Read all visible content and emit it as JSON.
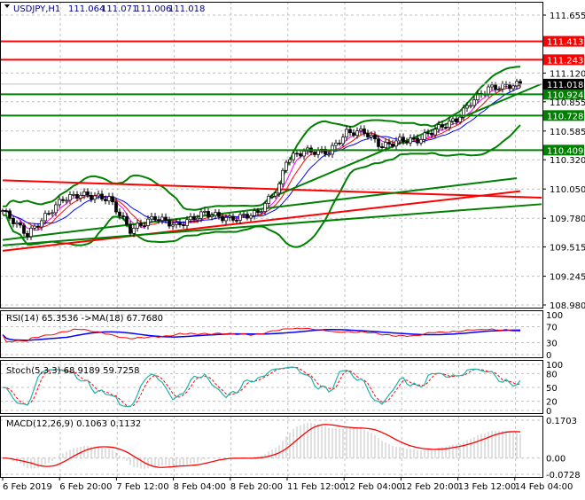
{
  "header": {
    "symbol": "USDJPY,H1",
    "open": "111.064",
    "high": "111.071",
    "low": "111.006",
    "close": "111.018"
  },
  "colors": {
    "bull": "#000000",
    "bear": "#000000",
    "level_red": "#ff0000",
    "level_green": "#008000",
    "current_price_bg": "#000000",
    "rsi": "#0000ff",
    "rsi_ma": "#ff0000",
    "stoch_main": "#20b2aa",
    "stoch_signal": "#ff0000",
    "macd_hist": "#c0c0c0",
    "macd_signal": "#ff0000",
    "grid": "#c0c0c0"
  },
  "chart_data": [
    {
      "type": "candlestick",
      "title": "USDJPY,H1",
      "timeframe": "H1",
      "ylim": [
        108.98,
        111.655
      ],
      "y_ticks": [
        "111.655",
        "111.120",
        "110.855",
        "110.585",
        "110.320",
        "110.050",
        "109.780",
        "109.515",
        "109.245",
        "108.980"
      ],
      "x_ticks": [
        "6 Feb 2019",
        "6 Feb 20:00",
        "7 Feb 12:00",
        "8 Feb 04:00",
        "8 Feb 20:00",
        "11 Feb 12:00",
        "12 Feb 04:00",
        "12 Feb 20:00",
        "13 Feb 12:00",
        "14 Feb 04:00"
      ],
      "close_path": [
        {
          "bar": 0,
          "close": 109.85
        },
        {
          "bar": 7,
          "close": 109.63
        },
        {
          "bar": 17,
          "close": 109.96
        },
        {
          "bar": 22,
          "close": 110.0
        },
        {
          "bar": 30,
          "close": 109.96
        },
        {
          "bar": 36,
          "close": 109.67
        },
        {
          "bar": 43,
          "close": 109.79
        },
        {
          "bar": 49,
          "close": 109.71
        },
        {
          "bar": 57,
          "close": 109.83
        },
        {
          "bar": 64,
          "close": 109.77
        },
        {
          "bar": 72,
          "close": 109.83
        },
        {
          "bar": 78,
          "close": 110.08
        },
        {
          "bar": 80,
          "close": 110.32
        },
        {
          "bar": 85,
          "close": 110.4
        },
        {
          "bar": 92,
          "close": 110.39
        },
        {
          "bar": 97,
          "close": 110.57
        },
        {
          "bar": 102,
          "close": 110.58
        },
        {
          "bar": 107,
          "close": 110.44
        },
        {
          "bar": 112,
          "close": 110.5
        },
        {
          "bar": 117,
          "close": 110.5
        },
        {
          "bar": 122,
          "close": 110.6
        },
        {
          "bar": 128,
          "close": 110.69
        },
        {
          "bar": 132,
          "close": 110.85
        },
        {
          "bar": 137,
          "close": 110.98
        },
        {
          "bar": 142,
          "close": 111.0
        },
        {
          "bar": 146,
          "close": 111.018
        }
      ],
      "levels": [
        {
          "price": 111.413,
          "label": "111.413",
          "color": "#ff0000"
        },
        {
          "price": 111.243,
          "label": "111.243",
          "color": "#ff0000"
        },
        {
          "price": 110.924,
          "label": "110.924",
          "color": "#008000"
        },
        {
          "price": 110.728,
          "label": "110.728",
          "color": "#008000"
        },
        {
          "price": 110.409,
          "label": "110.409",
          "color": "#008000"
        }
      ],
      "current_price": "111.018",
      "trendlines": [
        {
          "color": "#ff0000",
          "from": {
            "bar": 0,
            "price": 110.13
          },
          "to": {
            "bar": 152,
            "price": 109.97
          }
        },
        {
          "color": "#ff0000",
          "from": {
            "bar": 0,
            "price": 109.48
          },
          "to": {
            "bar": 146,
            "price": 110.03
          }
        },
        {
          "color": "#008000",
          "from": {
            "bar": 0,
            "price": 109.53
          },
          "to": {
            "bar": 152,
            "price": 109.91
          }
        },
        {
          "color": "#008000",
          "from": {
            "bar": 0,
            "price": 109.58
          },
          "to": {
            "bar": 145,
            "price": 110.15
          }
        },
        {
          "color": "#008000",
          "from": {
            "bar": 75,
            "price": 109.96
          },
          "to": {
            "bar": 152,
            "price": 111.02
          }
        }
      ]
    },
    {
      "type": "line",
      "title": "RSI(14) 65.3536 ->MA(18) 67.7680",
      "y_ticks": [
        "100",
        "70",
        "30",
        "0"
      ],
      "ylim": [
        0,
        100
      ]
    },
    {
      "type": "line",
      "title": "Stoch(5,3,3) 68.9189 59.7258",
      "y_ticks": [
        "100",
        "80",
        "50",
        "20",
        "0"
      ],
      "ylim": [
        0,
        100
      ]
    },
    {
      "type": "bar",
      "title": "MACD(12,26,9) 0.1063 0.1132",
      "y_ticks": [
        "0.1703",
        "0.00",
        "-0.0728"
      ],
      "ylim": [
        -0.0728,
        0.1703
      ]
    }
  ]
}
